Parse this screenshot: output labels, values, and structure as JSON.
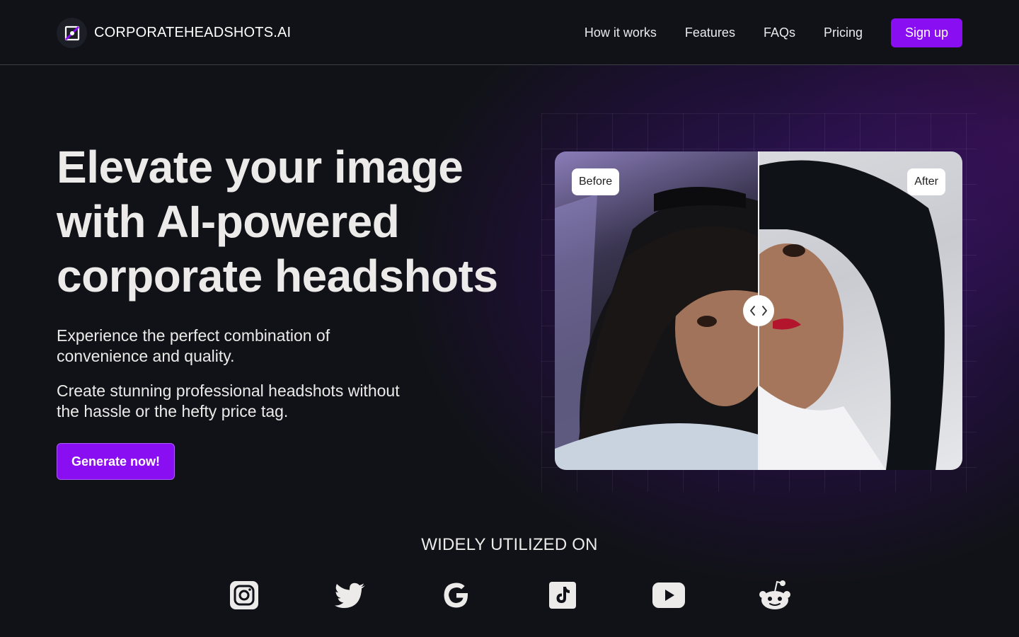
{
  "brand": {
    "name": "CORPORATEHEADSHOTS.AI",
    "logo_icon": "logo-mark-icon"
  },
  "nav": {
    "items": [
      {
        "label": "How it works"
      },
      {
        "label": "Features"
      },
      {
        "label": "FAQs"
      },
      {
        "label": "Pricing"
      }
    ],
    "signup_label": "Sign up"
  },
  "hero": {
    "title": "Elevate your image with AI-powered corporate headshots",
    "paragraph1": "Experience the perfect combination of convenience and quality.",
    "paragraph2": "Create stunning professional headshots without the hassle or the hefty price tag.",
    "cta_label": "Generate now!"
  },
  "comparison": {
    "before_label": "Before",
    "after_label": "After",
    "handle_icon": "drag-arrows-icon"
  },
  "widely": {
    "heading": "WIDELY UTILIZED ON",
    "platforms": [
      "instagram-icon",
      "twitter-icon",
      "google-icon",
      "tiktok-icon",
      "youtube-icon",
      "reddit-icon"
    ]
  },
  "colors": {
    "accent": "#8a0ef2",
    "background": "#111217",
    "text": "#ecebea"
  }
}
